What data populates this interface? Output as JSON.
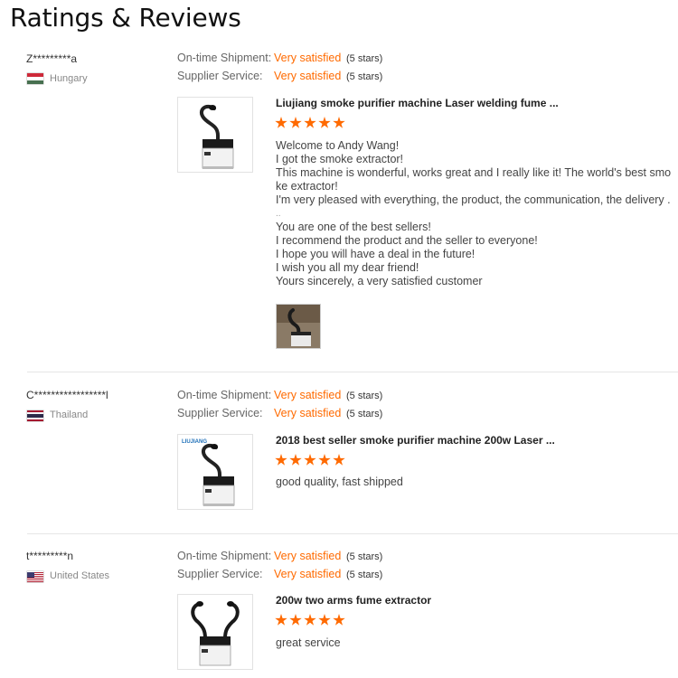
{
  "page_title": "Ratings & Reviews",
  "colors": {
    "accent": "#ff6a00",
    "label": "#666666",
    "country": "#888888"
  },
  "reviews": [
    {
      "buyer": "Z*********a",
      "country": "Hungary",
      "flag": "hungary-flag",
      "shipment_label": "On-time Shipment:",
      "shipment_value": "Very satisfied",
      "shipment_stars": "(5 stars)",
      "service_label": "Supplier Service:",
      "service_value": "Very satisfied",
      "service_stars": "(5 stars)",
      "product_title": "Liujiang smoke purifier machine Laser welding fume ...",
      "rating": 5,
      "body_lines": [
        "Welcome to Andy Wang!",
        "I got the smoke extractor!",
        "This machine is wonderful, works great and I really like it! The world's best smo",
        "ke extractor!",
        "I'm very pleased with everything, the product, the communication, the delivery .",
        "..",
        "You are one of the best sellers!",
        "I recommend the product and the seller to everyone!",
        "I hope you will have a deal in the future!",
        "I wish you all my dear friend!",
        "Yours sincerely, a very satisfied customer"
      ],
      "has_photo": true
    },
    {
      "buyer": "C*****************l",
      "country": "Thailand",
      "flag": "thailand-flag",
      "shipment_label": "On-time Shipment:",
      "shipment_value": "Very satisfied",
      "shipment_stars": "(5 stars)",
      "service_label": "Supplier Service:",
      "service_value": "Very satisfied",
      "service_stars": "(5 stars)",
      "product_title": "2018 best seller smoke purifier machine 200w Laser ...",
      "product_logo_text": "LIUJIANG",
      "rating": 5,
      "body_lines": [
        "good quality, fast shipped"
      ],
      "has_photo": false
    },
    {
      "buyer": "t*********n",
      "country": "United States",
      "flag": "united-states-flag",
      "shipment_label": "On-time Shipment:",
      "shipment_value": "Very satisfied",
      "shipment_stars": "(5 stars)",
      "service_label": "Supplier Service:",
      "service_value": "Very satisfied",
      "service_stars": "(5 stars)",
      "product_title": "200w two arms fume extractor",
      "rating": 5,
      "body_lines": [
        "great service"
      ],
      "has_photo": false
    }
  ]
}
